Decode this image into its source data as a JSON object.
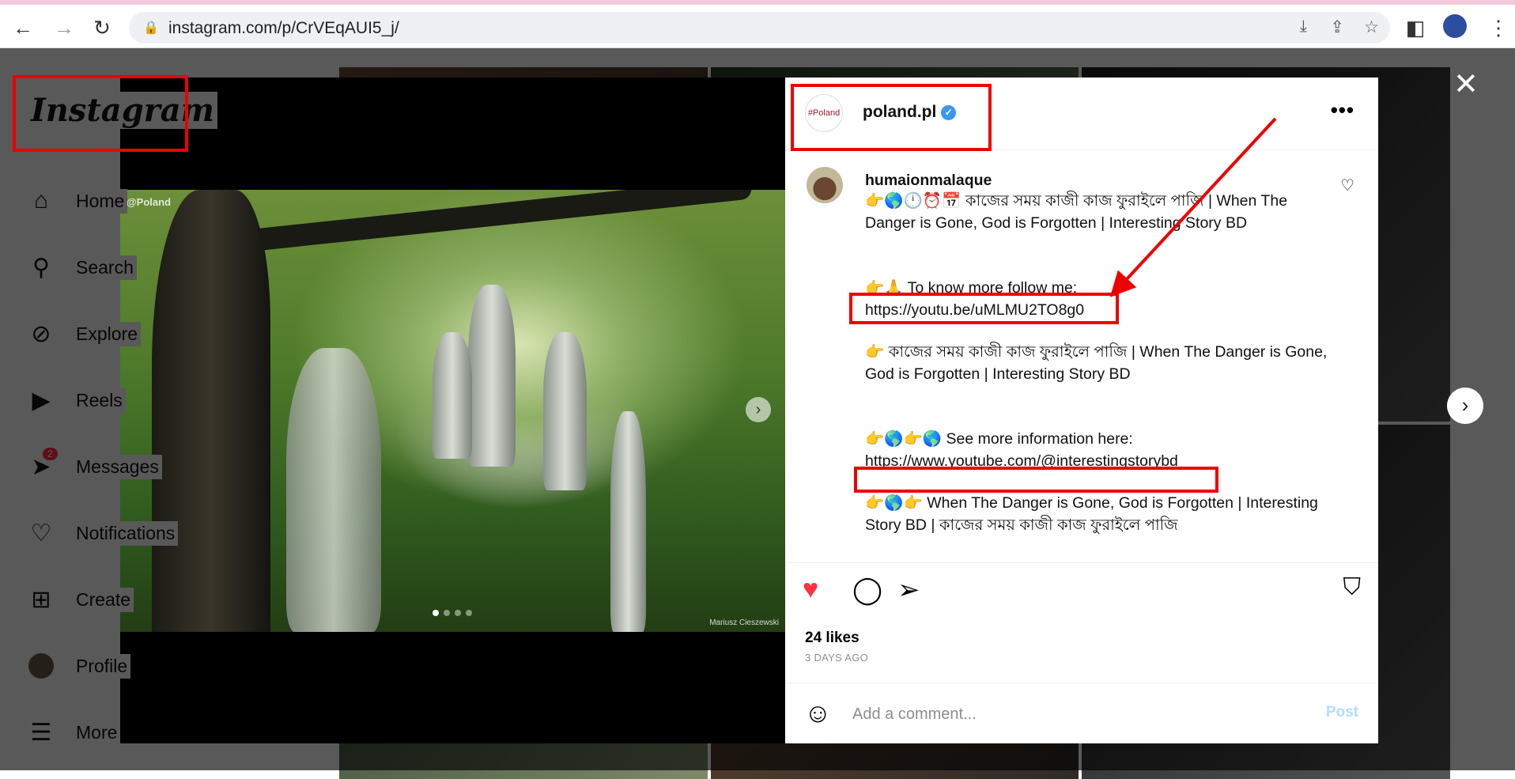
{
  "browser": {
    "url": "instagram.com/p/CrVEqAUI5_j/"
  },
  "sidebar": {
    "logo": "Instagram",
    "items": [
      {
        "label": "Home",
        "icon": "home-icon"
      },
      {
        "label": "Search",
        "icon": "search-icon"
      },
      {
        "label": "Explore",
        "icon": "compass-icon"
      },
      {
        "label": "Reels",
        "icon": "reels-icon"
      },
      {
        "label": "Messages",
        "icon": "messenger-icon",
        "badge": "2"
      },
      {
        "label": "Notifications",
        "icon": "heart-icon"
      },
      {
        "label": "Create",
        "icon": "plus-square-icon"
      },
      {
        "label": "Profile",
        "icon": "avatar"
      },
      {
        "label": "More",
        "icon": "menu-icon"
      }
    ]
  },
  "media": {
    "watermark": "@Poland",
    "credit": "Mariusz Cieszewski",
    "slide_count": 4,
    "current_slide": 1
  },
  "post": {
    "account": "poland.pl",
    "account_avatar_text": "#Poland",
    "verified": true,
    "comment": {
      "username": "humaionmalaque",
      "lines": [
        "👉🌎🕛⏰📅 কাজের সময় কাজী কাজ ফুরাইলে পাজি | When The Danger is Gone, God is Forgotten | Interesting Story BD",
        "👉🙏 To know more follow me:",
        "https://youtu.be/uMLMU2TO8g0",
        "👉 কাজের সময় কাজী কাজ ফুরাইলে পাজি | When The Danger is Gone, God is Forgotten | Interesting Story BD",
        "👉🌎👉🌎 See more information here:",
        "https://www.youtube.com/@interestingstorybd",
        "👉🌎👉 When The Danger is Gone, God is Forgotten | Interesting Story BD | কাজের সময় কাজী কাজ ফুরাইলে পাজি"
      ]
    },
    "liked": true,
    "likes": "24 likes",
    "time": "3 DAYS AGO",
    "comment_placeholder": "Add a comment...",
    "post_label": "Post"
  },
  "colors": {
    "annotation": "#ee0000",
    "like": "#ff3040",
    "verified": "#3897f0",
    "post_button": "#b3dbff"
  }
}
